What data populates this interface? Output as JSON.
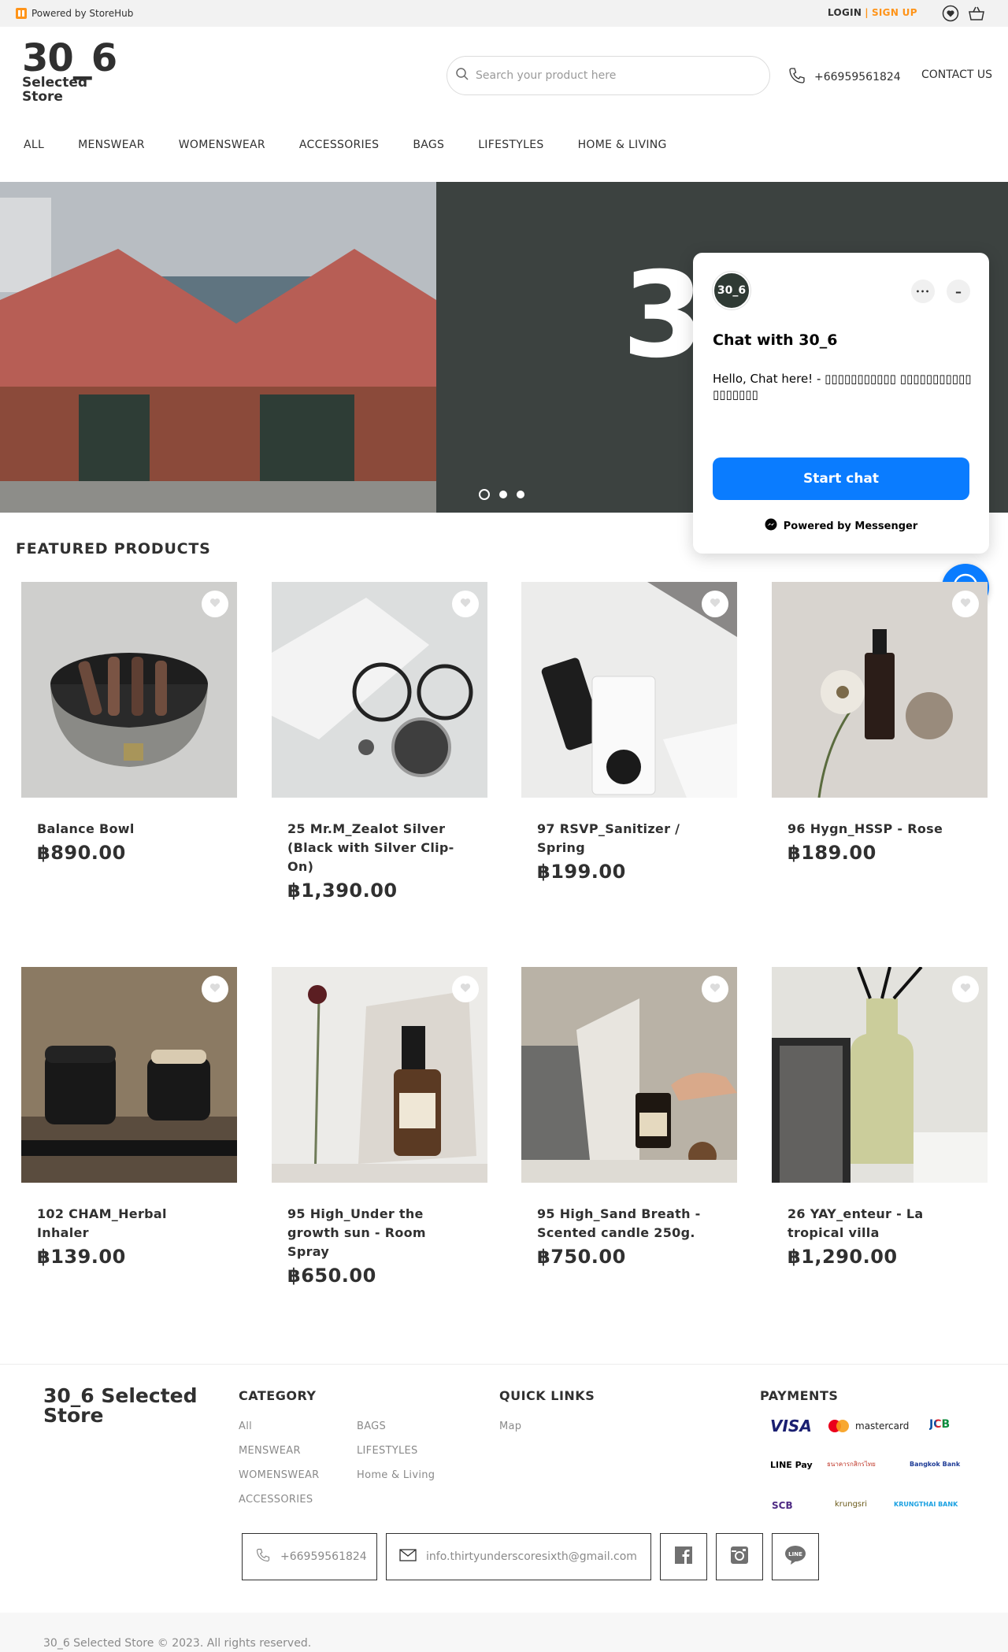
{
  "topbar": {
    "powered_by": "Powered by StoreHub",
    "login": "LOGIN",
    "separator": "|",
    "signup": "SIGN UP"
  },
  "header": {
    "logo_big": "30_6",
    "logo_line1": "Selected",
    "logo_line2": "Store",
    "search_placeholder": "Search your product here",
    "phone": "+66959561824",
    "contact": "CONTACT US"
  },
  "nav": [
    "ALL",
    "MENSWEAR",
    "WOMENSWEAR",
    "ACCESSORIES",
    "BAGS",
    "LIFESTYLES",
    "HOME & LIVING"
  ],
  "hero": {
    "title_visible": "3",
    "slide_count": 3,
    "active_slide": 1
  },
  "chat": {
    "avatar": "30_6",
    "title": "Chat with 30_6",
    "message": "Hello, Chat here! - ▯▯▯▯▯▯▯▯▯▯▯ ▯▯▯▯▯▯▯▯▯▯▯ ▯▯▯▯▯▯▯",
    "start": "Start chat",
    "powered": "Powered by Messenger",
    "more": "•••",
    "minimize": "–"
  },
  "featured": {
    "title": "FEATURED PRODUCTS",
    "products": [
      {
        "name": "Balance Bowl",
        "price": "฿890.00"
      },
      {
        "name": "25 Mr.M_Zealot Silver (Black with Silver Clip-On)",
        "price": "฿1,390.00"
      },
      {
        "name": "97 RSVP_Sanitizer / Spring",
        "price": "฿199.00"
      },
      {
        "name": "96 Hygn_HSSP - Rose",
        "price": "฿189.00"
      },
      {
        "name": "102 CHAM_Herbal Inhaler",
        "price": "฿139.00"
      },
      {
        "name": "95 High_Under the growth sun - Room Spray",
        "price": "฿650.00"
      },
      {
        "name": "95 High_Sand Breath - Scented candle 250g.",
        "price": "฿750.00"
      },
      {
        "name": "26 YAY_enteur - La tropical villa",
        "price": "฿1,290.00"
      }
    ]
  },
  "footer": {
    "brand": "30_6 Selected Store",
    "category_title": "CATEGORY",
    "category_col1": [
      "All",
      "MENSWEAR",
      "WOMENSWEAR",
      "ACCESSORIES"
    ],
    "category_col2": [
      "BAGS",
      "LIFESTYLES",
      "Home & Living"
    ],
    "quick_title": "QUICK LINKS",
    "quick_links": [
      "Map"
    ],
    "payments_title": "PAYMENTS",
    "payments": [
      "VISA",
      "mastercard",
      "JCB",
      "LINE Pay",
      "ธนาคารกสิกรไทย",
      "Bangkok Bank",
      "SCB",
      "krungsri",
      "KRUNGTHAI BANK"
    ],
    "phone": "+66959561824",
    "email": "info.thirtyunderscoresixth@gmail.com",
    "copyright": "30_6 Selected Store © 2023. All rights reserved."
  },
  "colors": {
    "accent": "#ff9419",
    "hero_bg": "#3c4240",
    "messenger_blue": "#0a7cff"
  }
}
